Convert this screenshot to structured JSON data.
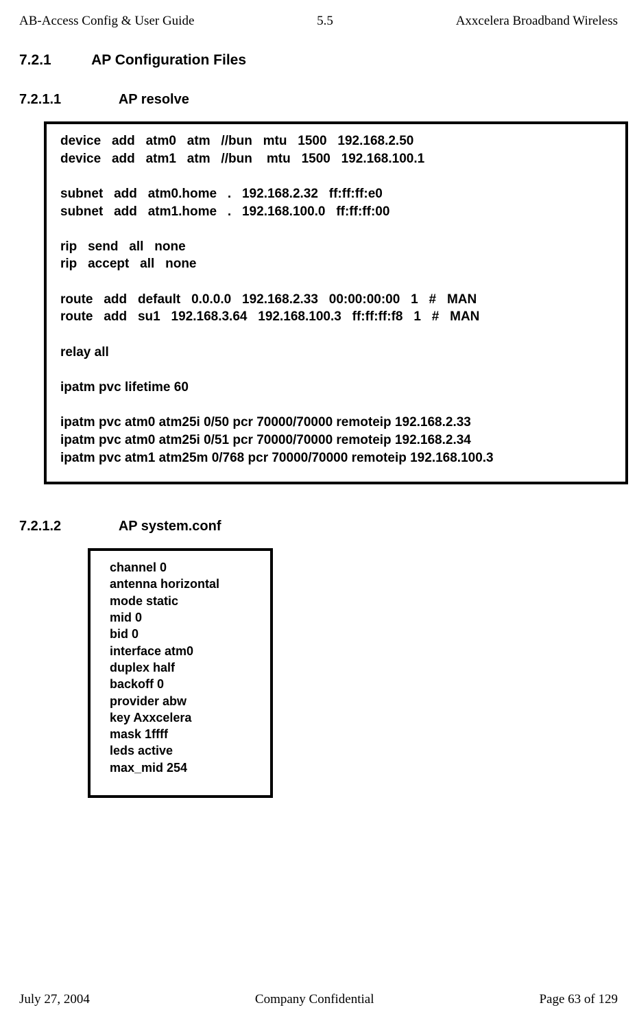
{
  "header": {
    "left": "AB-Access Config & User Guide",
    "center": "5.5",
    "right": "Axxcelera Broadband Wireless"
  },
  "section_721": {
    "num": "7.2.1",
    "title": "AP Configuration Files"
  },
  "section_7211": {
    "num": "7.2.1.1",
    "title": "AP resolve"
  },
  "codebox1": "device   add   atm0   atm   //bun   mtu   1500   192.168.2.50\ndevice   add   atm1   atm   //bun    mtu   1500   192.168.100.1\n\nsubnet   add   atm0.home   .   192.168.2.32   ff:ff:ff:e0\nsubnet   add   atm1.home   .   192.168.100.0   ff:ff:ff:00\n\nrip   send   all   none\nrip   accept   all   none\n\nroute   add   default   0.0.0.0   192.168.2.33   00:00:00:00   1   #   MAN\nroute   add   su1   192.168.3.64   192.168.100.3   ff:ff:ff:f8   1   #   MAN\n\nrelay all\n\nipatm pvc lifetime 60\n\nipatm pvc atm0 atm25i 0/50 pcr 70000/70000 remoteip 192.168.2.33\nipatm pvc atm0 atm25i 0/51 pcr 70000/70000 remoteip 192.168.2.34\nipatm pvc atm1 atm25m 0/768 pcr 70000/70000 remoteip 192.168.100.3",
  "section_7212": {
    "num": "7.2.1.2",
    "title": "AP system.conf"
  },
  "codebox2": "channel 0\nantenna horizontal\nmode static\nmid 0\nbid 0\ninterface atm0\nduplex half\nbackoff 0\nprovider abw\nkey Axxcelera\nmask 1ffff\nleds active\nmax_mid 254",
  "footer": {
    "left": "July 27, 2004",
    "center": "Company Confidential",
    "right": "Page 63 of 129"
  }
}
